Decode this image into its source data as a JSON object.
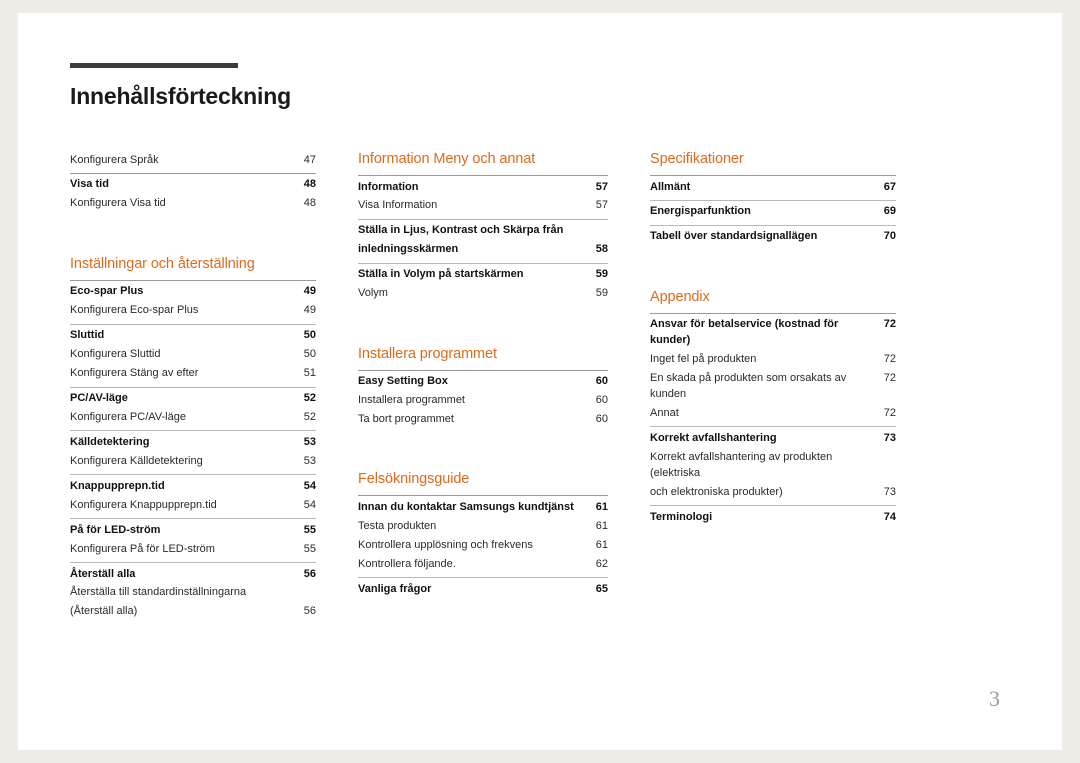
{
  "page": {
    "title": "Innehållsförteckning",
    "folio": "3",
    "accent_color": "#e06a1b"
  },
  "columns": {
    "left": {
      "blocks": [
        {
          "heading": null,
          "rules": {
            "before": false
          },
          "entries": [
            {
              "label": "Konfigurera Språk",
              "page": "47",
              "bold": false,
              "rule_after": false
            },
            {
              "label": "Visa tid",
              "page": "48",
              "bold": true,
              "rule_before": true
            },
            {
              "label": "Konfigurera Visa tid",
              "page": "48",
              "bold": false,
              "rule_after": true
            }
          ]
        },
        {
          "heading": "Inställningar och återställning",
          "entries": [
            {
              "label": "Eco-spar Plus",
              "page": "49",
              "bold": true
            },
            {
              "label": "Konfigurera Eco-spar Plus",
              "page": "49",
              "bold": false
            },
            {
              "label": "Sluttid",
              "page": "50",
              "bold": true
            },
            {
              "label": "Konfigurera Sluttid",
              "page": "50",
              "bold": false
            },
            {
              "label": "Konfigurera Stäng av efter",
              "page": "51",
              "bold": false
            },
            {
              "label": "PC/AV-läge",
              "page": "52",
              "bold": true
            },
            {
              "label": "Konfigurera PC/AV-läge",
              "page": "52",
              "bold": false
            },
            {
              "label": "Källdetektering",
              "page": "53",
              "bold": true
            },
            {
              "label": "Konfigurera Källdetektering",
              "page": "53",
              "bold": false
            },
            {
              "label": "Knappupprepn.tid",
              "page": "54",
              "bold": true
            },
            {
              "label": "Konfigurera Knappupprepn.tid",
              "page": "54",
              "bold": false
            },
            {
              "label": "På för LED-ström",
              "page": "55",
              "bold": true
            },
            {
              "label": "Konfigurera På för LED-ström",
              "page": "55",
              "bold": false
            },
            {
              "label": "Återställ alla",
              "page": "56",
              "bold": true
            },
            {
              "label": "Återställa till standardinställningarna",
              "page": "",
              "bold": false
            },
            {
              "label": "(Återställ alla)",
              "page": "56",
              "bold": false
            }
          ]
        }
      ]
    },
    "middle": {
      "blocks": [
        {
          "heading": "Information Meny och annat",
          "entries": [
            {
              "label": "Information",
              "page": "57",
              "bold": true
            },
            {
              "label": "Visa Information",
              "page": "57",
              "bold": false
            },
            {
              "label": "Ställa in Ljus, Kontrast och Skärpa från",
              "page": "",
              "bold": true
            },
            {
              "label": "inledningsskärmen",
              "page": "58",
              "bold": true
            },
            {
              "label": "Ställa in Volym på startskärmen",
              "page": "59",
              "bold": true
            },
            {
              "label": "Volym",
              "page": "59",
              "bold": false
            }
          ]
        },
        {
          "heading": "Installera programmet",
          "entries": [
            {
              "label": "Easy Setting Box",
              "page": "60",
              "bold": true
            },
            {
              "label": "Installera programmet",
              "page": "60",
              "bold": false
            },
            {
              "label": "Ta bort programmet",
              "page": "60",
              "bold": false
            }
          ]
        },
        {
          "heading": "Felsökningsguide",
          "entries": [
            {
              "label": "Innan du kontaktar Samsungs kundtjänst",
              "page": "61",
              "bold": true
            },
            {
              "label": "Testa produkten",
              "page": "61",
              "bold": false
            },
            {
              "label": "Kontrollera upplösning och frekvens",
              "page": "61",
              "bold": false
            },
            {
              "label": "Kontrollera följande.",
              "page": "62",
              "bold": false
            },
            {
              "label": "Vanliga frågor",
              "page": "65",
              "bold": true
            }
          ]
        }
      ]
    },
    "right": {
      "blocks": [
        {
          "heading": "Specifikationer",
          "entries": [
            {
              "label": "Allmänt",
              "page": "67",
              "bold": true
            },
            {
              "label": "Energisparfunktion",
              "page": "69",
              "bold": true
            },
            {
              "label": "Tabell över standardsignallägen",
              "page": "70",
              "bold": true
            }
          ]
        },
        {
          "heading": "Appendix",
          "entries": [
            {
              "label": "Ansvar för betalservice (kostnad för kunder)",
              "page": "72",
              "bold": true
            },
            {
              "label": "Inget fel på produkten",
              "page": "72",
              "bold": false
            },
            {
              "label": "En skada på produkten som orsakats av kunden",
              "page": "72",
              "bold": false
            },
            {
              "label": "Annat",
              "page": "72",
              "bold": false
            },
            {
              "label": "Korrekt avfallshantering",
              "page": "73",
              "bold": true
            },
            {
              "label": "Korrekt avfallshantering av produkten (elektriska",
              "page": "",
              "bold": false
            },
            {
              "label": "och elektroniska produkter)",
              "page": "73",
              "bold": false
            },
            {
              "label": "Terminologi",
              "page": "74",
              "bold": true
            }
          ]
        }
      ]
    }
  }
}
